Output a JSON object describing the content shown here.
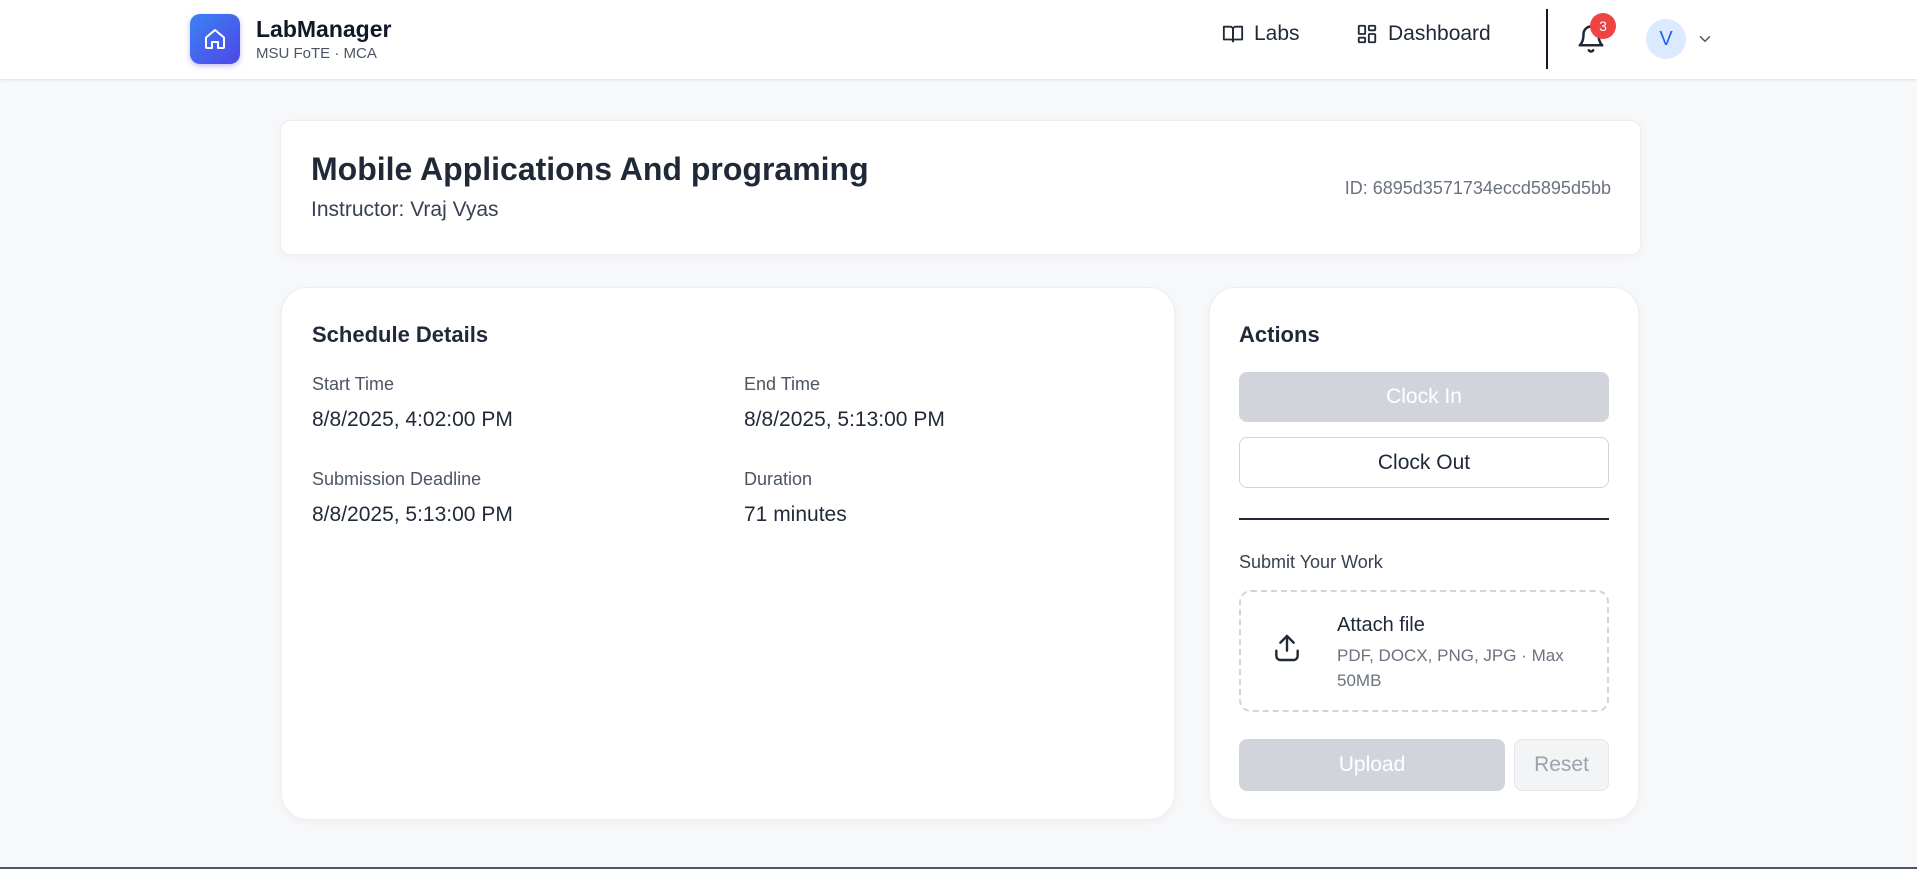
{
  "header": {
    "brand_title": "LabManager",
    "brand_subtitle": "MSU FoTE · MCA",
    "nav": [
      {
        "label": "Labs",
        "icon": "book-open-icon"
      },
      {
        "label": "Dashboard",
        "icon": "grid-icon"
      }
    ],
    "notification_count": "3",
    "avatar_initial": "V"
  },
  "course": {
    "title": "Mobile Applications And programing",
    "instructor": "Instructor: Vraj Vyas",
    "id_text": "ID: 6895d3571734eccd5895d5bb"
  },
  "schedule": {
    "title": "Schedule Details",
    "fields": [
      {
        "label": "Start Time",
        "value": "8/8/2025, 4:02:00 PM"
      },
      {
        "label": "End Time",
        "value": "8/8/2025, 5:13:00 PM"
      },
      {
        "label": "Submission Deadline",
        "value": "8/8/2025, 5:13:00 PM"
      },
      {
        "label": "Duration",
        "value": "71 minutes"
      }
    ]
  },
  "actions": {
    "title": "Actions",
    "clock_in_label": "Clock In",
    "clock_out_label": "Clock Out",
    "submit_label": "Submit Your Work",
    "attach_title": "Attach file",
    "attach_hint": "PDF, DOCX, PNG, JPG · Max 50MB",
    "upload_label": "Upload",
    "reset_label": "Reset"
  },
  "colors": {
    "accent": "#4f46e5",
    "badge": "#ef4444",
    "disabled": "#d1d5db"
  }
}
